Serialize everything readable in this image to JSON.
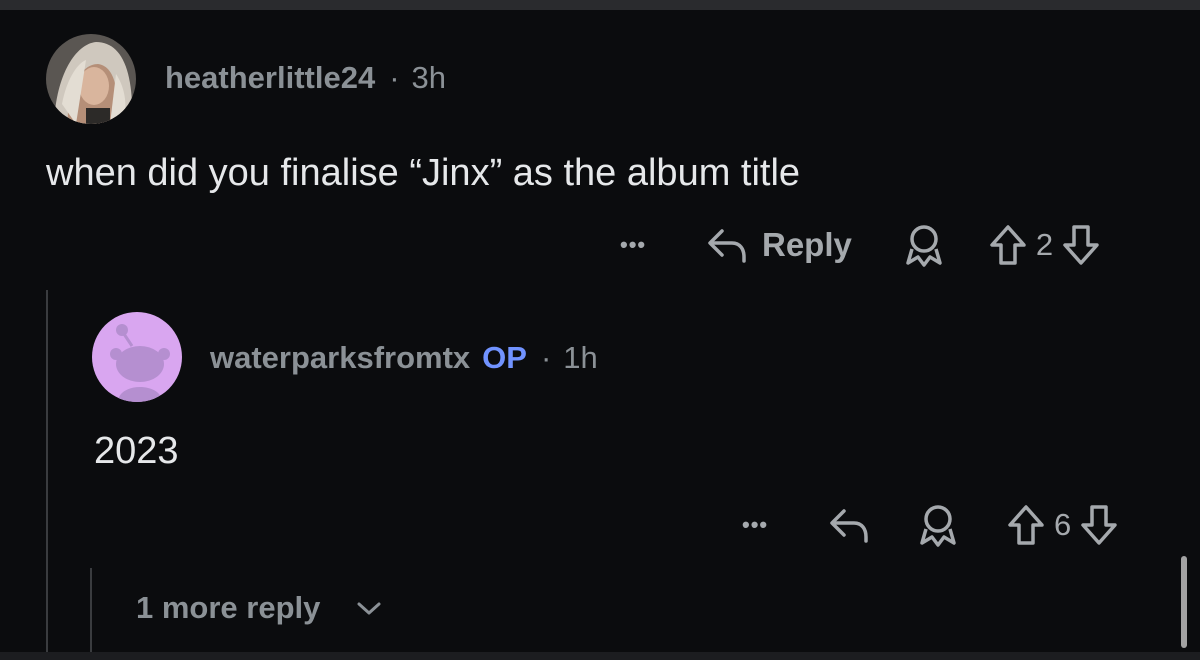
{
  "comments": [
    {
      "username": "heatherlittle24",
      "separator": "·",
      "time": "3h",
      "body": "when did you finalise “Jinx” as the album title",
      "actions": {
        "more_label": "•••",
        "reply_label": "Reply",
        "score": "2"
      }
    },
    {
      "username": "waterparksfromtx",
      "op_badge": "OP",
      "separator": "·",
      "time": "1h",
      "body": "2023",
      "actions": {
        "more_label": "•••",
        "score": "6"
      }
    }
  ],
  "more_replies": {
    "label": "1 more reply"
  },
  "colors": {
    "background": "#0b0c0e",
    "op_badge": "#7193ff",
    "muted": "#8b9196",
    "text": "#e6e8ea"
  },
  "icons": [
    "reply-arrow-icon",
    "award-icon",
    "upvote-arrow-icon",
    "downvote-arrow-icon",
    "chevron-down-icon"
  ]
}
